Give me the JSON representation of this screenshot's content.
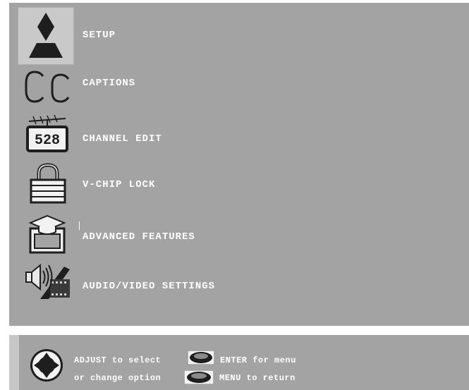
{
  "menu": {
    "items": [
      {
        "label": "SETUP",
        "icon": "mitsubishi-logo-icon",
        "selected": true
      },
      {
        "label": "CAPTIONS",
        "icon": "cc-icon"
      },
      {
        "label": "CHANNEL EDIT",
        "icon": "channel-antenna-icon"
      },
      {
        "label": "V-CHIP LOCK",
        "icon": "padlock-icon"
      },
      {
        "label": "ADVANCED FEATURES",
        "icon": "graduation-cap-box-icon"
      },
      {
        "label": "AUDIO/VIDEO SETTINGS",
        "icon": "speaker-film-icon"
      }
    ],
    "channel_icon_digits": "528"
  },
  "help": {
    "line1_left": "ADJUST to select",
    "line1_right": "ENTER for menu",
    "line2_left": "or change option",
    "line2_right": "MENU to return",
    "icons": [
      "dpad-icon",
      "enter-button-icon",
      "menu-button-icon"
    ]
  },
  "colors": {
    "panel": "#a3a3a3",
    "text": "#ffffff",
    "icon_dark": "#1e1e1e",
    "selection": "#c9c9c9"
  }
}
